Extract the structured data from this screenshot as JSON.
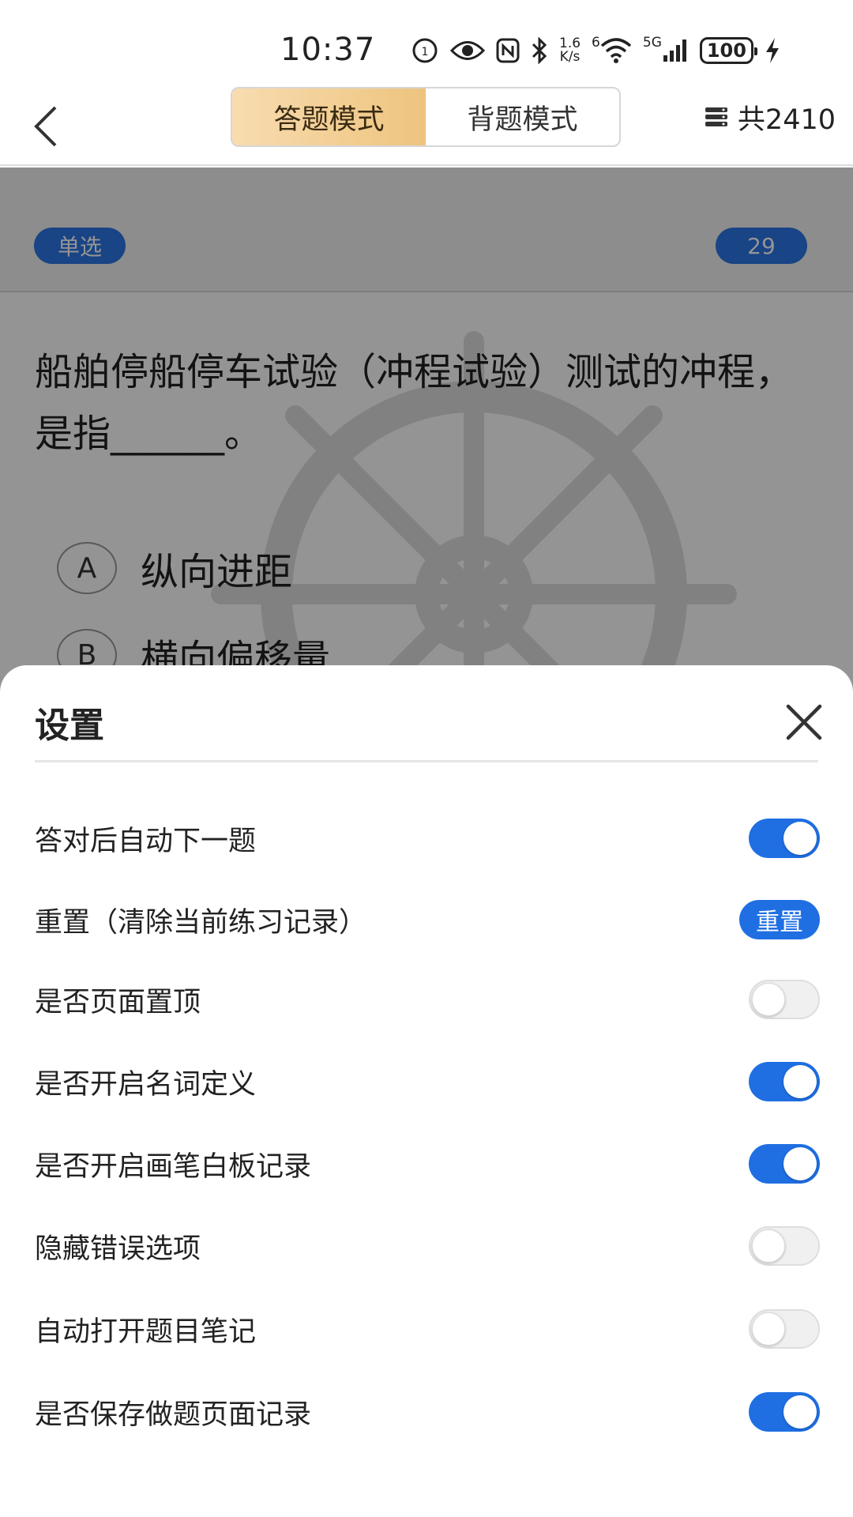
{
  "status_bar": {
    "time": "10:37",
    "net_speed_top": "1.6",
    "net_speed_bottom": "K/s",
    "wifi_label": "6",
    "signal_label": "5G",
    "battery": "100"
  },
  "app_bar": {
    "tabs": [
      {
        "label": "答题模式",
        "active": true
      },
      {
        "label": "背题模式",
        "active": false
      }
    ],
    "total": "共2410"
  },
  "question": {
    "type": "单选",
    "number": "29",
    "text": "船舶停船停车试验（冲程试验）测试的冲程，是指______。",
    "options": [
      {
        "letter": "A",
        "text": "纵向进距"
      },
      {
        "letter": "B",
        "text": "横向偏移量"
      }
    ]
  },
  "settings": {
    "title": "设置",
    "items": [
      {
        "label": "答对后自动下一题",
        "control": "toggle",
        "on": true
      },
      {
        "label": "重置（清除当前练习记录）",
        "control": "button",
        "button_label": "重置"
      },
      {
        "label": "是否页面置顶",
        "control": "toggle",
        "on": false
      },
      {
        "label": "是否开启名词定义",
        "control": "toggle",
        "on": true
      },
      {
        "label": "是否开启画笔白板记录",
        "control": "toggle",
        "on": true
      },
      {
        "label": "隐藏错误选项",
        "control": "toggle",
        "on": false
      },
      {
        "label": "自动打开题目笔记",
        "control": "toggle",
        "on": false
      },
      {
        "label": "是否保存做题页面记录",
        "control": "toggle",
        "on": true
      }
    ]
  },
  "colors": {
    "accent_blue": "#1f6fe3",
    "active_tab_gold": "#edc47e"
  }
}
